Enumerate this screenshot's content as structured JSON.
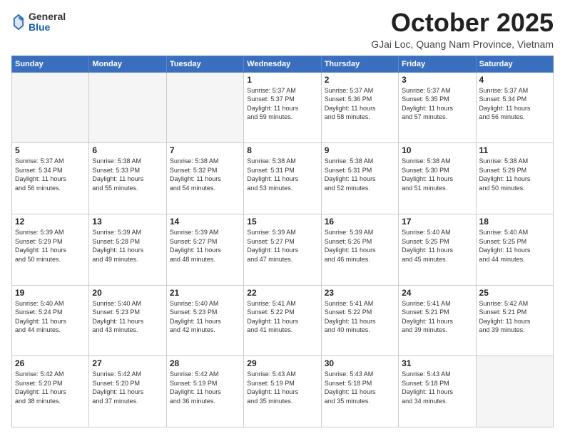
{
  "header": {
    "logo_general": "General",
    "logo_blue": "Blue",
    "month_title": "October 2025",
    "location": "GJai Loc, Quang Nam Province, Vietnam"
  },
  "weekdays": [
    "Sunday",
    "Monday",
    "Tuesday",
    "Wednesday",
    "Thursday",
    "Friday",
    "Saturday"
  ],
  "weeks": [
    [
      {
        "day": "",
        "info": ""
      },
      {
        "day": "",
        "info": ""
      },
      {
        "day": "",
        "info": ""
      },
      {
        "day": "1",
        "info": "Sunrise: 5:37 AM\nSunset: 5:37 PM\nDaylight: 11 hours\nand 59 minutes."
      },
      {
        "day": "2",
        "info": "Sunrise: 5:37 AM\nSunset: 5:36 PM\nDaylight: 11 hours\nand 58 minutes."
      },
      {
        "day": "3",
        "info": "Sunrise: 5:37 AM\nSunset: 5:35 PM\nDaylight: 11 hours\nand 57 minutes."
      },
      {
        "day": "4",
        "info": "Sunrise: 5:37 AM\nSunset: 5:34 PM\nDaylight: 11 hours\nand 56 minutes."
      }
    ],
    [
      {
        "day": "5",
        "info": "Sunrise: 5:37 AM\nSunset: 5:34 PM\nDaylight: 11 hours\nand 56 minutes."
      },
      {
        "day": "6",
        "info": "Sunrise: 5:38 AM\nSunset: 5:33 PM\nDaylight: 11 hours\nand 55 minutes."
      },
      {
        "day": "7",
        "info": "Sunrise: 5:38 AM\nSunset: 5:32 PM\nDaylight: 11 hours\nand 54 minutes."
      },
      {
        "day": "8",
        "info": "Sunrise: 5:38 AM\nSunset: 5:31 PM\nDaylight: 11 hours\nand 53 minutes."
      },
      {
        "day": "9",
        "info": "Sunrise: 5:38 AM\nSunset: 5:31 PM\nDaylight: 11 hours\nand 52 minutes."
      },
      {
        "day": "10",
        "info": "Sunrise: 5:38 AM\nSunset: 5:30 PM\nDaylight: 11 hours\nand 51 minutes."
      },
      {
        "day": "11",
        "info": "Sunrise: 5:38 AM\nSunset: 5:29 PM\nDaylight: 11 hours\nand 50 minutes."
      }
    ],
    [
      {
        "day": "12",
        "info": "Sunrise: 5:39 AM\nSunset: 5:29 PM\nDaylight: 11 hours\nand 50 minutes."
      },
      {
        "day": "13",
        "info": "Sunrise: 5:39 AM\nSunset: 5:28 PM\nDaylight: 11 hours\nand 49 minutes."
      },
      {
        "day": "14",
        "info": "Sunrise: 5:39 AM\nSunset: 5:27 PM\nDaylight: 11 hours\nand 48 minutes."
      },
      {
        "day": "15",
        "info": "Sunrise: 5:39 AM\nSunset: 5:27 PM\nDaylight: 11 hours\nand 47 minutes."
      },
      {
        "day": "16",
        "info": "Sunrise: 5:39 AM\nSunset: 5:26 PM\nDaylight: 11 hours\nand 46 minutes."
      },
      {
        "day": "17",
        "info": "Sunrise: 5:40 AM\nSunset: 5:25 PM\nDaylight: 11 hours\nand 45 minutes."
      },
      {
        "day": "18",
        "info": "Sunrise: 5:40 AM\nSunset: 5:25 PM\nDaylight: 11 hours\nand 44 minutes."
      }
    ],
    [
      {
        "day": "19",
        "info": "Sunrise: 5:40 AM\nSunset: 5:24 PM\nDaylight: 11 hours\nand 44 minutes."
      },
      {
        "day": "20",
        "info": "Sunrise: 5:40 AM\nSunset: 5:23 PM\nDaylight: 11 hours\nand 43 minutes."
      },
      {
        "day": "21",
        "info": "Sunrise: 5:40 AM\nSunset: 5:23 PM\nDaylight: 11 hours\nand 42 minutes."
      },
      {
        "day": "22",
        "info": "Sunrise: 5:41 AM\nSunset: 5:22 PM\nDaylight: 11 hours\nand 41 minutes."
      },
      {
        "day": "23",
        "info": "Sunrise: 5:41 AM\nSunset: 5:22 PM\nDaylight: 11 hours\nand 40 minutes."
      },
      {
        "day": "24",
        "info": "Sunrise: 5:41 AM\nSunset: 5:21 PM\nDaylight: 11 hours\nand 39 minutes."
      },
      {
        "day": "25",
        "info": "Sunrise: 5:42 AM\nSunset: 5:21 PM\nDaylight: 11 hours\nand 39 minutes."
      }
    ],
    [
      {
        "day": "26",
        "info": "Sunrise: 5:42 AM\nSunset: 5:20 PM\nDaylight: 11 hours\nand 38 minutes."
      },
      {
        "day": "27",
        "info": "Sunrise: 5:42 AM\nSunset: 5:20 PM\nDaylight: 11 hours\nand 37 minutes."
      },
      {
        "day": "28",
        "info": "Sunrise: 5:42 AM\nSunset: 5:19 PM\nDaylight: 11 hours\nand 36 minutes."
      },
      {
        "day": "29",
        "info": "Sunrise: 5:43 AM\nSunset: 5:19 PM\nDaylight: 11 hours\nand 35 minutes."
      },
      {
        "day": "30",
        "info": "Sunrise: 5:43 AM\nSunset: 5:18 PM\nDaylight: 11 hours\nand 35 minutes."
      },
      {
        "day": "31",
        "info": "Sunrise: 5:43 AM\nSunset: 5:18 PM\nDaylight: 11 hours\nand 34 minutes."
      },
      {
        "day": "",
        "info": ""
      }
    ]
  ]
}
